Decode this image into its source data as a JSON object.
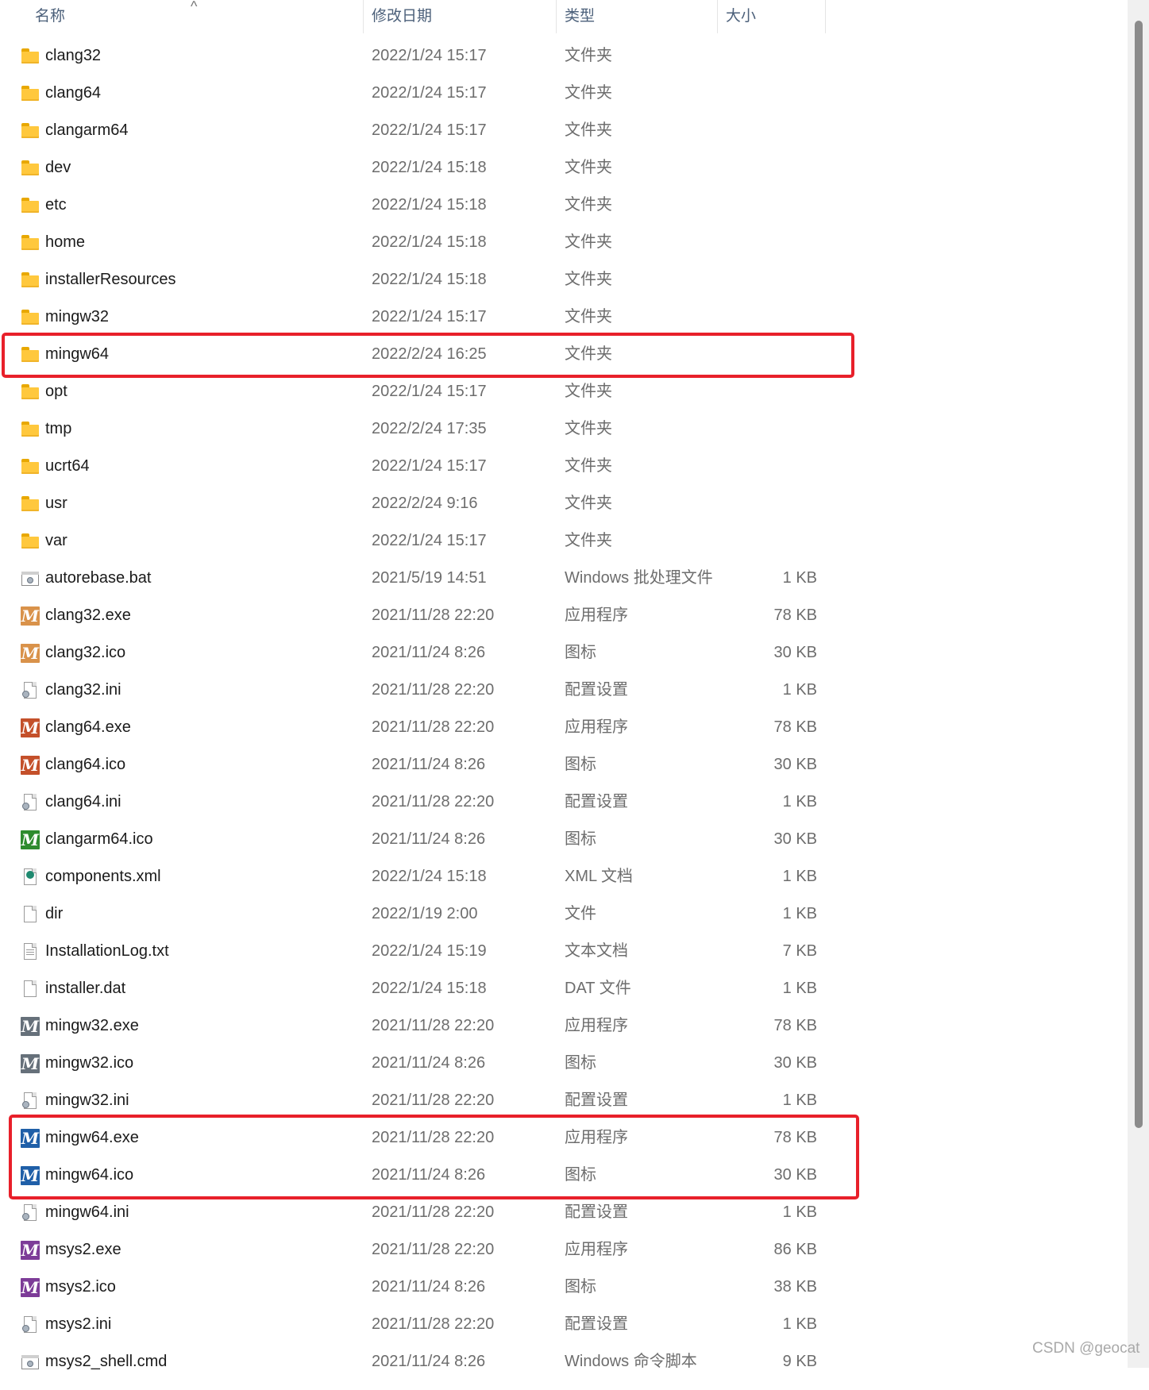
{
  "columns": {
    "name": "名称",
    "date": "修改日期",
    "type": "类型",
    "size": "大小",
    "sort_indicator": "^"
  },
  "files": [
    {
      "name": "clang32",
      "date": "2022/1/24 15:17",
      "type": "文件夹",
      "size": "",
      "icon": "folder-icon"
    },
    {
      "name": "clang64",
      "date": "2022/1/24 15:17",
      "type": "文件夹",
      "size": "",
      "icon": "folder-icon"
    },
    {
      "name": "clangarm64",
      "date": "2022/1/24 15:17",
      "type": "文件夹",
      "size": "",
      "icon": "folder-icon"
    },
    {
      "name": "dev",
      "date": "2022/1/24 15:18",
      "type": "文件夹",
      "size": "",
      "icon": "folder-icon"
    },
    {
      "name": "etc",
      "date": "2022/1/24 15:18",
      "type": "文件夹",
      "size": "",
      "icon": "folder-icon"
    },
    {
      "name": "home",
      "date": "2022/1/24 15:18",
      "type": "文件夹",
      "size": "",
      "icon": "folder-icon"
    },
    {
      "name": "installerResources",
      "date": "2022/1/24 15:18",
      "type": "文件夹",
      "size": "",
      "icon": "folder-icon"
    },
    {
      "name": "mingw32",
      "date": "2022/1/24 15:17",
      "type": "文件夹",
      "size": "",
      "icon": "folder-icon"
    },
    {
      "name": "mingw64",
      "date": "2022/2/24 16:25",
      "type": "文件夹",
      "size": "",
      "icon": "folder-icon"
    },
    {
      "name": "opt",
      "date": "2022/1/24 15:17",
      "type": "文件夹",
      "size": "",
      "icon": "folder-icon"
    },
    {
      "name": "tmp",
      "date": "2022/2/24 17:35",
      "type": "文件夹",
      "size": "",
      "icon": "folder-icon"
    },
    {
      "name": "ucrt64",
      "date": "2022/1/24 15:17",
      "type": "文件夹",
      "size": "",
      "icon": "folder-icon"
    },
    {
      "name": "usr",
      "date": "2022/2/24 9:16",
      "type": "文件夹",
      "size": "",
      "icon": "folder-icon"
    },
    {
      "name": "var",
      "date": "2022/1/24 15:17",
      "type": "文件夹",
      "size": "",
      "icon": "folder-icon"
    },
    {
      "name": "autorebase.bat",
      "date": "2021/5/19 14:51",
      "type": "Windows 批处理文件",
      "size": "1 KB",
      "icon": "batch-file-icon"
    },
    {
      "name": "clang32.exe",
      "date": "2021/11/28 22:20",
      "type": "应用程序",
      "size": "78 KB",
      "icon": "msys-m-icon",
      "icon_color": "#d9924a"
    },
    {
      "name": "clang32.ico",
      "date": "2021/11/24 8:26",
      "type": "图标",
      "size": "30 KB",
      "icon": "msys-m-icon",
      "icon_color": "#d9924a"
    },
    {
      "name": "clang32.ini",
      "date": "2021/11/28 22:20",
      "type": "配置设置",
      "size": "1 KB",
      "icon": "settings-file-icon"
    },
    {
      "name": "clang64.exe",
      "date": "2021/11/28 22:20",
      "type": "应用程序",
      "size": "78 KB",
      "icon": "msys-m-icon",
      "icon_color": "#c4502a"
    },
    {
      "name": "clang64.ico",
      "date": "2021/11/24 8:26",
      "type": "图标",
      "size": "30 KB",
      "icon": "msys-m-icon",
      "icon_color": "#c4502a"
    },
    {
      "name": "clang64.ini",
      "date": "2021/11/28 22:20",
      "type": "配置设置",
      "size": "1 KB",
      "icon": "settings-file-icon"
    },
    {
      "name": "clangarm64.ico",
      "date": "2021/11/24 8:26",
      "type": "图标",
      "size": "30 KB",
      "icon": "msys-m-icon",
      "icon_color": "#2e8b2e"
    },
    {
      "name": "components.xml",
      "date": "2022/1/24 15:18",
      "type": "XML 文档",
      "size": "1 KB",
      "icon": "xml-file-icon"
    },
    {
      "name": "dir",
      "date": "2022/1/19 2:00",
      "type": "文件",
      "size": "1 KB",
      "icon": "blank-file-icon"
    },
    {
      "name": "InstallationLog.txt",
      "date": "2022/1/24 15:19",
      "type": "文本文档",
      "size": "7 KB",
      "icon": "text-file-icon"
    },
    {
      "name": "installer.dat",
      "date": "2022/1/24 15:18",
      "type": "DAT 文件",
      "size": "1 KB",
      "icon": "blank-file-icon"
    },
    {
      "name": "mingw32.exe",
      "date": "2021/11/28 22:20",
      "type": "应用程序",
      "size": "78 KB",
      "icon": "msys-m-icon",
      "icon_color": "#66707a"
    },
    {
      "name": "mingw32.ico",
      "date": "2021/11/24 8:26",
      "type": "图标",
      "size": "30 KB",
      "icon": "msys-m-icon",
      "icon_color": "#66707a"
    },
    {
      "name": "mingw32.ini",
      "date": "2021/11/28 22:20",
      "type": "配置设置",
      "size": "1 KB",
      "icon": "settings-file-icon"
    },
    {
      "name": "mingw64.exe",
      "date": "2021/11/28 22:20",
      "type": "应用程序",
      "size": "78 KB",
      "icon": "msys-m-icon",
      "icon_color": "#1f5fa8"
    },
    {
      "name": "mingw64.ico",
      "date": "2021/11/24 8:26",
      "type": "图标",
      "size": "30 KB",
      "icon": "msys-m-icon",
      "icon_color": "#1f5fa8"
    },
    {
      "name": "mingw64.ini",
      "date": "2021/11/28 22:20",
      "type": "配置设置",
      "size": "1 KB",
      "icon": "settings-file-icon"
    },
    {
      "name": "msys2.exe",
      "date": "2021/11/28 22:20",
      "type": "应用程序",
      "size": "86 KB",
      "icon": "msys-m-icon",
      "icon_color": "#7d3c98"
    },
    {
      "name": "msys2.ico",
      "date": "2021/11/24 8:26",
      "type": "图标",
      "size": "38 KB",
      "icon": "msys-m-icon",
      "icon_color": "#7d3c98"
    },
    {
      "name": "msys2.ini",
      "date": "2021/11/28 22:20",
      "type": "配置设置",
      "size": "1 KB",
      "icon": "settings-file-icon"
    },
    {
      "name": "msys2_shell.cmd",
      "date": "2021/11/24 8:26",
      "type": "Windows 命令脚本",
      "size": "9 KB",
      "icon": "batch-file-icon"
    }
  ],
  "highlight_color": "#e8202a",
  "watermark": "CSDN @geocat"
}
